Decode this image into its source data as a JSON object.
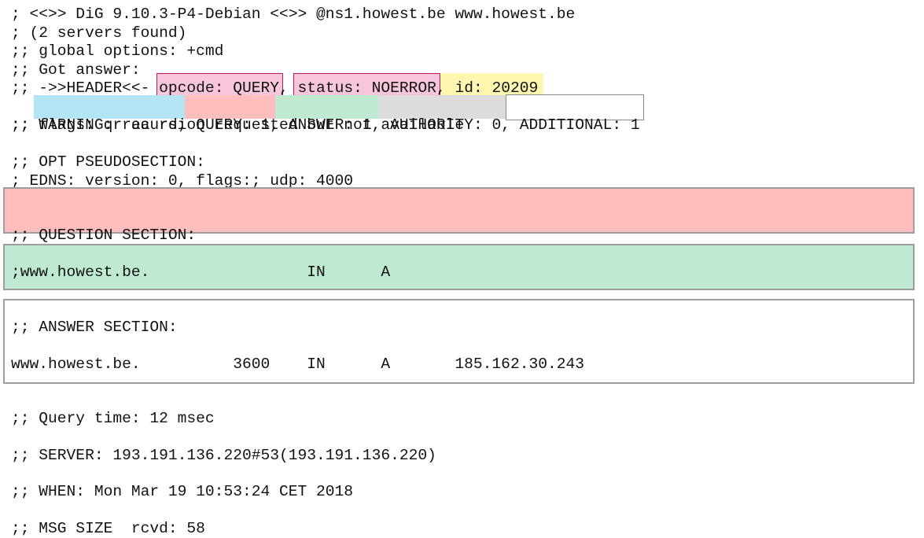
{
  "colors": {
    "opcode_box_fill": "#f7c6dc",
    "opcode_box_border": "#c2185b",
    "status_box_fill": "#f7c6dc",
    "status_box_border": "#c2185b",
    "id_highlight": "#fdf7b0",
    "flags_highlight": "#b3e5f5",
    "query_highlight": "#ffbdbd",
    "answer_highlight": "#bfe9d3",
    "authority_highlight": "#dcdcdc",
    "additional_box_border": "#888888",
    "question_section_fill": "#ffbdbd",
    "answer_section_fill": "#bfe9d3",
    "stats_section_fill": "#ffffff",
    "section_border": "#9e9e9e"
  },
  "header": {
    "line1": "; <<>> DiG 9.10.3-P4-Debian <<>> @ns1.howest.be www.howest.be",
    "line2": "; (2 servers found)",
    "line3": ";; global options: +cmd",
    "line4": ";; Got answer:",
    "header_prefix": ";; ->>HEADER<<- ",
    "opcode": "opcode: QUERY",
    "sep1": ", ",
    "status": "status: NOERROR",
    "sep2": ", ",
    "id": "id: 20209",
    "flags_prefix": ";; ",
    "flags": "flags: qr aa rd;",
    "query_count": " QUERY: 1,",
    "answer_count": " ANSWER: 1,",
    "authority_count": " AUTHORITY: 0,",
    "additional_count": " ADDITIONAL: 1",
    "warning": ";; WARNING: recursion requested but not available"
  },
  "opt_section": {
    "title": ";; OPT PSEUDOSECTION:",
    "edns": "; EDNS: version: 0, flags:; udp: 4000"
  },
  "question_section": {
    "title": ";; QUESTION SECTION:",
    "record": ";www.howest.be.                 IN      A"
  },
  "answer_section": {
    "title": ";; ANSWER SECTION:",
    "record": "www.howest.be.          3600    IN      A       185.162.30.243"
  },
  "stats_section": {
    "query_time": ";; Query time: 12 msec",
    "server": ";; SERVER: 193.191.136.220#53(193.191.136.220)",
    "when": ";; WHEN: Mon Mar 19 10:53:24 CET 2018",
    "msg_size": ";; MSG SIZE  rcvd: 58"
  }
}
